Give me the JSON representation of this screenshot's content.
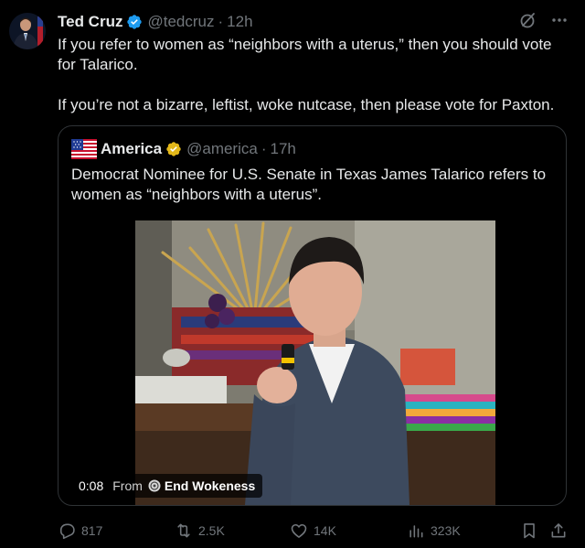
{
  "post": {
    "author": {
      "display_name": "Ted Cruz",
      "handle": "@tedcruz",
      "separator": "·",
      "time": "12h",
      "verified_badge": "verified-badge-icon",
      "badge_color": "#1d9bf0"
    },
    "text_lines": [
      "If you refer to women as “neighbors with a uterus,” then you should vote for Talarico.",
      "If you’re not a bizarre, leftist, woke nutcase, then please vote for Paxton."
    ],
    "top_icons": [
      "grok-icon",
      "more-icon"
    ]
  },
  "quote": {
    "author": {
      "display_name": "America",
      "handle": "@america",
      "separator": "·",
      "time": "17h",
      "avatar_icon": "us-flag-icon",
      "verified_badge": "gold-verified-badge-icon",
      "badge_color": "#e2b719"
    },
    "text": "Democrat Nominee for U.S. Senate in Texas James Talarico refers to women as “neighbors with a uterus”.",
    "video": {
      "duration": "0:08",
      "from_label": "From",
      "source_name": "End Wokeness"
    }
  },
  "actions": {
    "reply": {
      "icon": "reply-icon",
      "count": "817"
    },
    "retweet": {
      "icon": "retweet-icon",
      "count": "2.5K"
    },
    "like": {
      "icon": "like-icon",
      "count": "14K"
    },
    "views": {
      "icon": "views-icon",
      "count": "323K"
    },
    "bookmark": {
      "icon": "bookmark-icon"
    },
    "share": {
      "icon": "share-icon"
    }
  },
  "colors": {
    "background": "#000000",
    "text": "#e7e9ea",
    "muted": "#71767b",
    "border": "#2f3336"
  }
}
